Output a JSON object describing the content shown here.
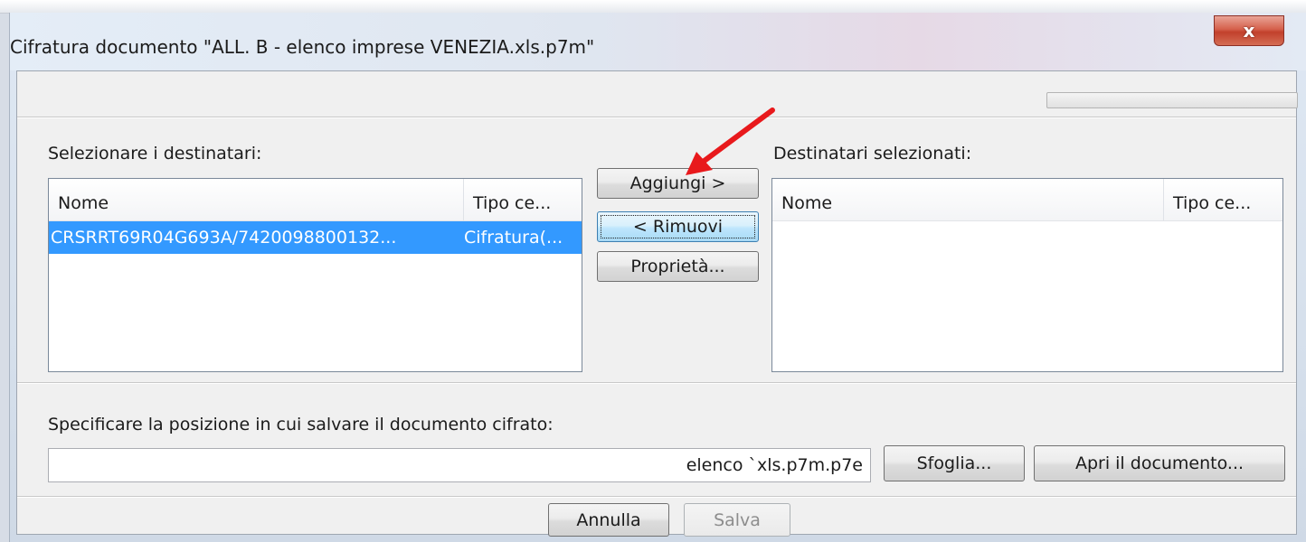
{
  "window": {
    "title": "Cifratura documento \"ALL. B - elenco imprese VENEZIA.xls.p7m\"",
    "close_label": "x"
  },
  "recipients": {
    "label": "Selezionare i destinatari:",
    "columns": [
      "Nome",
      "Tipo ce..."
    ],
    "rows": [
      {
        "name": "CRSRRT69R04G693A/7420098800132...",
        "type": "Cifratura(...",
        "selected": true
      }
    ]
  },
  "actions": {
    "add_label": "Aggiungi >",
    "remove_label": "< Rimuovi",
    "properties_label": "Proprietà..."
  },
  "selected_recipients": {
    "label": "Destinatari selezionati:",
    "columns": [
      "Nome",
      "Tipo ce..."
    ]
  },
  "save_location": {
    "label": "Specificare la posizione in cui salvare il documento cifrato:",
    "value": "elenco `xls.p7m.p7e",
    "browse_label": "Sfoglia...",
    "open_label": "Apri il documento..."
  },
  "footer": {
    "cancel_label": "Annulla",
    "save_label": "Salva"
  },
  "colors": {
    "selection": "#3399ff",
    "annotation_arrow": "#e8191c"
  }
}
